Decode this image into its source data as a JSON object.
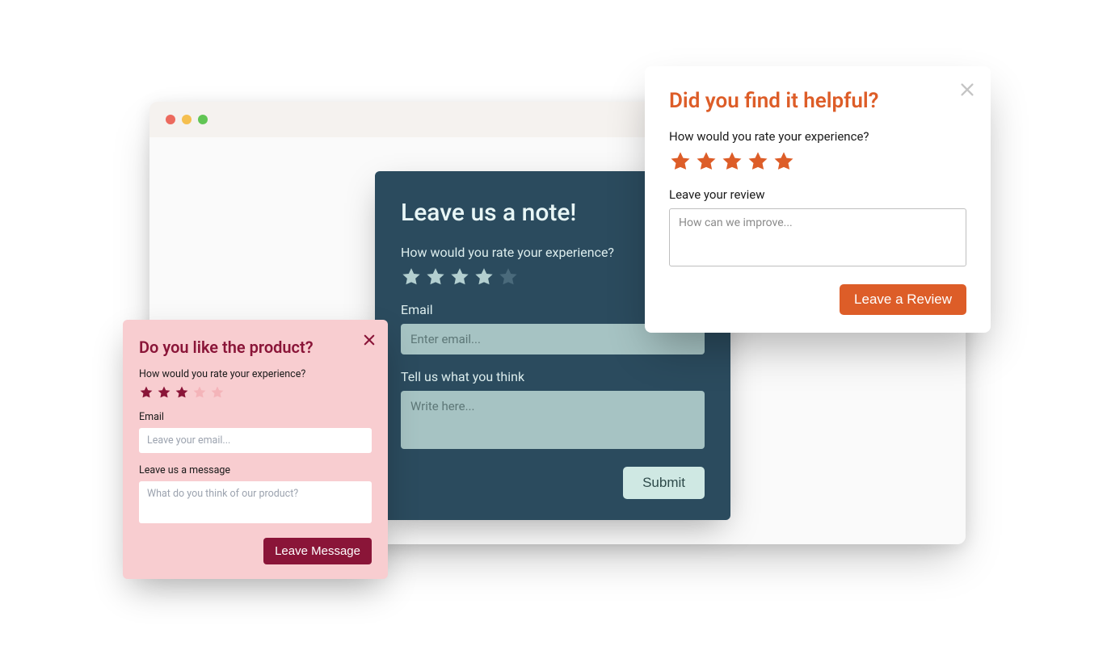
{
  "browser": {
    "traffic_colors": [
      "#ec6a5e",
      "#f5bf4f",
      "#61c554"
    ]
  },
  "card_center": {
    "title": "Leave us a note!",
    "rate_label": "How would you rate your experience?",
    "rating": 4,
    "rating_max": 5,
    "email_label": "Email",
    "email_placeholder": "Enter email...",
    "message_label": "Tell us what you think",
    "message_placeholder": "Write here...",
    "submit_label": "Submit",
    "colors": {
      "bg": "#2b4b5e",
      "star_filled": "#b3cfd0",
      "star_empty": "#4a6a7b",
      "button_bg": "#cfe8e3"
    }
  },
  "card_left": {
    "title": "Do you like the product?",
    "rate_label": "How would you rate your experience?",
    "rating": 3,
    "rating_max": 5,
    "email_label": "Email",
    "email_placeholder": "Leave your email...",
    "message_label": "Leave us a message",
    "message_placeholder": "What do you think of our product?",
    "submit_label": "Leave Message",
    "colors": {
      "bg": "#f8cdd0",
      "accent": "#8a1538",
      "star_filled": "#8a1538",
      "star_empty": "#f4b4b9"
    }
  },
  "card_right": {
    "title": "Did you find it helpful?",
    "rate_label": "How would you rate your experience?",
    "rating": 5,
    "rating_max": 5,
    "review_label": "Leave your review",
    "review_placeholder": "How can we improve...",
    "submit_label": "Leave a Review",
    "colors": {
      "bg": "#ffffff",
      "accent": "#dd5d28",
      "star_filled": "#dd5d28",
      "close": "#c4c4c4"
    }
  }
}
